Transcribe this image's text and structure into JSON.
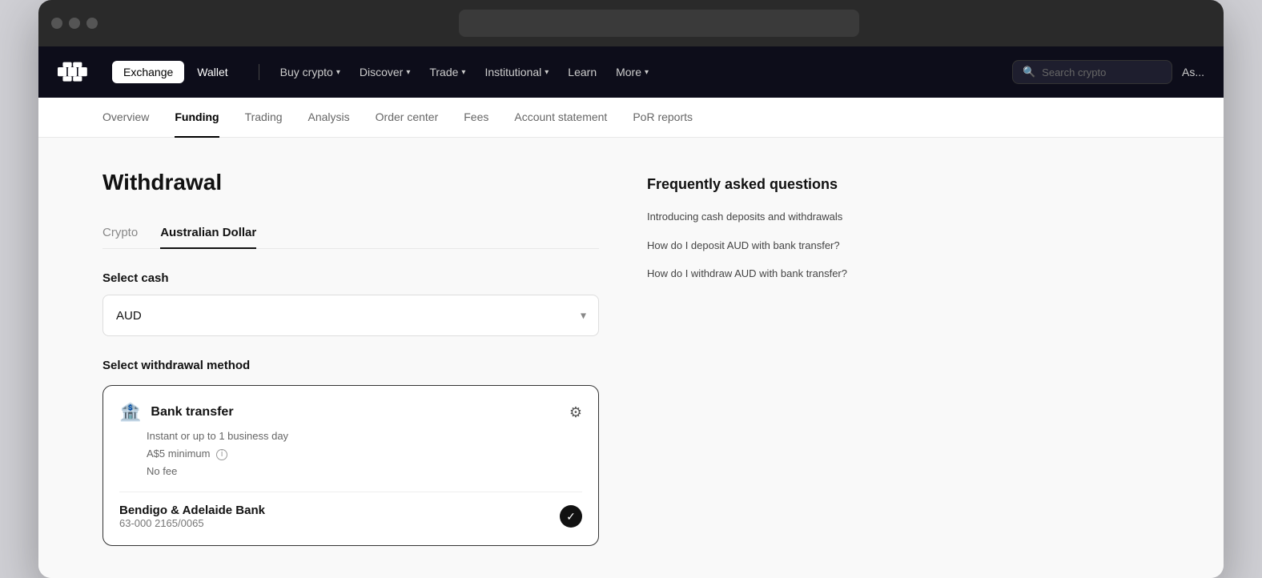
{
  "browser": {
    "traffic_lights": [
      "close",
      "minimize",
      "maximize"
    ]
  },
  "topnav": {
    "tabs": [
      {
        "label": "Exchange",
        "active": true
      },
      {
        "label": "Wallet",
        "active": false
      }
    ],
    "links": [
      {
        "label": "Buy crypto",
        "has_chevron": true
      },
      {
        "label": "Discover",
        "has_chevron": true
      },
      {
        "label": "Trade",
        "has_chevron": true
      },
      {
        "label": "Institutional",
        "has_chevron": true
      },
      {
        "label": "Learn",
        "has_chevron": false
      },
      {
        "label": "More",
        "has_chevron": true
      }
    ],
    "search_placeholder": "Search crypto",
    "user_label": "As..."
  },
  "subnav": {
    "items": [
      {
        "label": "Overview",
        "active": false
      },
      {
        "label": "Funding",
        "active": true
      },
      {
        "label": "Trading",
        "active": false
      },
      {
        "label": "Analysis",
        "active": false
      },
      {
        "label": "Order center",
        "active": false
      },
      {
        "label": "Fees",
        "active": false
      },
      {
        "label": "Account statement",
        "active": false
      },
      {
        "label": "PoR reports",
        "active": false
      }
    ]
  },
  "page": {
    "title": "Withdrawal",
    "tabs": [
      {
        "label": "Crypto",
        "active": false
      },
      {
        "label": "Australian Dollar",
        "active": true
      }
    ],
    "select_cash_label": "Select cash",
    "select_cash_value": "AUD",
    "select_cash_placeholder": "AUD",
    "withdrawal_method_label": "Select withdrawal method",
    "bank_transfer": {
      "title": "Bank transfer",
      "subtitle1": "Instant or up to 1 business day",
      "subtitle2": "A$5 minimum",
      "subtitle3": "No fee",
      "account_name": "Bendigo & Adelaide Bank",
      "account_number": "63-000 2165/0065"
    }
  },
  "faq": {
    "title": "Frequently asked questions",
    "items": [
      {
        "label": "Introducing cash deposits and withdrawals"
      },
      {
        "label": "How do I deposit AUD with bank transfer?"
      },
      {
        "label": "How do I withdraw AUD with bank transfer?"
      }
    ]
  }
}
